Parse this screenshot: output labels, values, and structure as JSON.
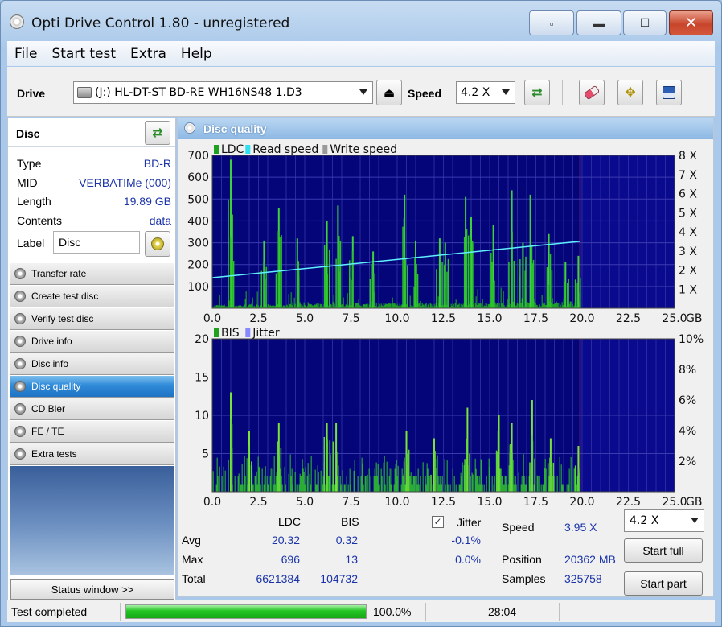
{
  "window": {
    "title": "Opti Drive Control 1.80 - unregistered"
  },
  "menu": [
    {
      "label": "File"
    },
    {
      "label": "Start test"
    },
    {
      "label": "Extra"
    },
    {
      "label": "Help"
    }
  ],
  "toolbar": {
    "drive_label": "Drive",
    "drive_value": "(J:)   HL-DT-ST BD-RE  WH16NS48 1.D3",
    "speed_label": "Speed",
    "speed_value": "4.2 X"
  },
  "disc": {
    "header": "Disc",
    "rows": [
      {
        "key": "Type",
        "value": "BD-R"
      },
      {
        "key": "MID",
        "value": "VERBATIMe (000)"
      },
      {
        "key": "Length",
        "value": "19.89 GB"
      },
      {
        "key": "Contents",
        "value": "data"
      }
    ],
    "label_key": "Label",
    "label_value": "Disc"
  },
  "nav": [
    {
      "label": "Transfer rate"
    },
    {
      "label": "Create test disc"
    },
    {
      "label": "Verify test disc"
    },
    {
      "label": "Drive info"
    },
    {
      "label": "Disc info"
    },
    {
      "label": "Disc quality",
      "active": true
    },
    {
      "label": "CD Bler"
    },
    {
      "label": "FE / TE"
    },
    {
      "label": "Extra tests"
    }
  ],
  "status_window_label": "Status window >>",
  "panel_title": "Disc quality",
  "chart_data": [
    {
      "type": "bar",
      "legend": [
        "LDC",
        "Read speed",
        "Write speed"
      ],
      "legend_colors": [
        "#1fa01f",
        "#2fe0f0",
        "#9a9a9a"
      ],
      "xlim": [
        0,
        25
      ],
      "x_ticks": [
        "0.0",
        "2.5",
        "5.0",
        "7.5",
        "10.0",
        "12.5",
        "15.0",
        "17.5",
        "20.0",
        "22.5",
        "25.0"
      ],
      "x_unit": "GB",
      "ylim": [
        0,
        700
      ],
      "y_ticks": [
        "100",
        "200",
        "300",
        "400",
        "500",
        "600",
        "700"
      ],
      "y2_ticks": [
        "1 X",
        "2 X",
        "3 X",
        "4 X",
        "5 X",
        "6 X",
        "7 X",
        "8 X"
      ],
      "data_end_gb": 19.89,
      "peaks": [
        {
          "x": 1.0,
          "y": 680
        },
        {
          "x": 2.8,
          "y": 310
        },
        {
          "x": 3.6,
          "y": 460
        },
        {
          "x": 4.6,
          "y": 320
        },
        {
          "x": 6.2,
          "y": 400
        },
        {
          "x": 6.8,
          "y": 470
        },
        {
          "x": 7.6,
          "y": 330
        },
        {
          "x": 8.7,
          "y": 260
        },
        {
          "x": 10.4,
          "y": 520
        },
        {
          "x": 11.0,
          "y": 310
        },
        {
          "x": 12.3,
          "y": 320
        },
        {
          "x": 12.6,
          "y": 300
        },
        {
          "x": 13.7,
          "y": 510
        },
        {
          "x": 14.0,
          "y": 420
        },
        {
          "x": 15.2,
          "y": 380
        },
        {
          "x": 16.2,
          "y": 540
        },
        {
          "x": 16.8,
          "y": 300
        },
        {
          "x": 17.2,
          "y": 520
        },
        {
          "x": 18.2,
          "y": 340
        },
        {
          "x": 19.1,
          "y": 210
        },
        {
          "x": 19.8,
          "y": 240
        }
      ],
      "read_speed": {
        "x": [
          0,
          19.89
        ],
        "y": [
          1.6,
          3.5
        ]
      }
    },
    {
      "type": "bar",
      "legend": [
        "BIS",
        "Jitter"
      ],
      "legend_colors": [
        "#1fa01f",
        "#8888ff"
      ],
      "xlim": [
        0,
        25
      ],
      "x_ticks": [
        "0.0",
        "2.5",
        "5.0",
        "7.5",
        "10.0",
        "12.5",
        "15.0",
        "17.5",
        "20.0",
        "22.5",
        "25.0"
      ],
      "x_unit": "GB",
      "ylim": [
        0,
        20
      ],
      "y_ticks": [
        "5",
        "10",
        "15",
        "20"
      ],
      "y2_ticks": [
        "2%",
        "4%",
        "6%",
        "8%",
        "10%"
      ],
      "data_end_gb": 19.89,
      "peaks": [
        {
          "x": 1.0,
          "y": 13
        },
        {
          "x": 2.0,
          "y": 8
        },
        {
          "x": 3.6,
          "y": 9
        },
        {
          "x": 6.2,
          "y": 9
        },
        {
          "x": 6.7,
          "y": 9
        },
        {
          "x": 10.5,
          "y": 8
        },
        {
          "x": 12.0,
          "y": 7
        },
        {
          "x": 13.8,
          "y": 11
        },
        {
          "x": 15.5,
          "y": 10
        },
        {
          "x": 16.2,
          "y": 9
        },
        {
          "x": 17.3,
          "y": 12
        },
        {
          "x": 18.3,
          "y": 7
        },
        {
          "x": 19.8,
          "y": 6
        }
      ]
    }
  ],
  "stats": {
    "col_ldc": "LDC",
    "col_bis": "BIS",
    "jitter_label": "Jitter",
    "jitter_checked": true,
    "rows": [
      {
        "label": "Avg",
        "ldc": "20.32",
        "bis": "0.32",
        "jitter": "-0.1%"
      },
      {
        "label": "Max",
        "ldc": "696",
        "bis": "13",
        "jitter": "0.0%"
      },
      {
        "label": "Total",
        "ldc": "6621384",
        "bis": "104732"
      }
    ],
    "speed_label": "Speed",
    "speed_value": "3.95 X",
    "position_label": "Position",
    "position_value": "20362 MB",
    "samples_label": "Samples",
    "samples_value": "325758",
    "test_speed": "4.2 X",
    "start_full": "Start full",
    "start_part": "Start part"
  },
  "statusbar": {
    "text": "Test completed",
    "progress": 100,
    "percent_text": "100.0%",
    "time": "28:04"
  }
}
